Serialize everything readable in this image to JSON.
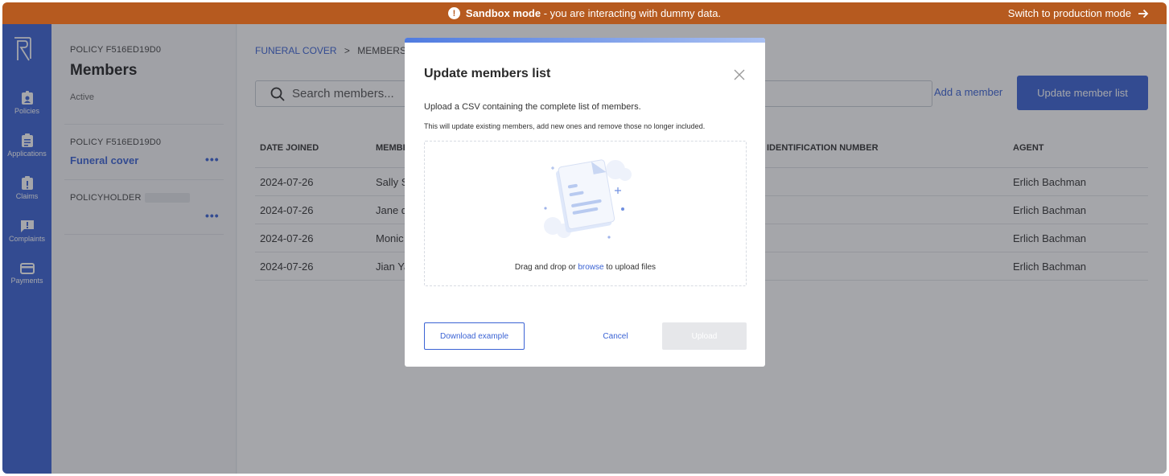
{
  "banner": {
    "title": "Sandbox mode",
    "message": " - you are interacting with dummy data.",
    "switch_label": "Switch to production mode"
  },
  "rail": {
    "items": [
      {
        "label": "Policies",
        "icon": "badge-icon"
      },
      {
        "label": "Applications",
        "icon": "clipboard-icon"
      },
      {
        "label": "Claims",
        "icon": "clipboard-alert-icon"
      },
      {
        "label": "Complaints",
        "icon": "chat-alert-icon"
      },
      {
        "label": "Payments",
        "icon": "card-icon"
      }
    ]
  },
  "sidebar": {
    "policy_label": "POLICY F516ED19D0",
    "title": "Members",
    "status": "Active",
    "policy_label_2": "POLICY F516ED19D0",
    "product_link": "Funeral cover",
    "policyholder_label": "POLICYHOLDER"
  },
  "main": {
    "breadcrumb": {
      "root": "FUNERAL COVER",
      "separator": ">",
      "current": "MEMBERS"
    },
    "search_placeholder": "Search members...",
    "add_member_label": "Add a member",
    "update_button_label": "Update member list",
    "table": {
      "headers": [
        "DATE JOINED",
        "MEMBER",
        "IDENTIFICATION NUMBER",
        "AGENT"
      ],
      "rows": [
        {
          "date": "2024-07-26",
          "member": "Sally S",
          "agent": "Erlich Bachman"
        },
        {
          "date": "2024-07-26",
          "member": "Jane d",
          "agent": "Erlich Bachman"
        },
        {
          "date": "2024-07-26",
          "member": "Monic",
          "agent": "Erlich Bachman"
        },
        {
          "date": "2024-07-26",
          "member": "Jian Ya",
          "agent": "Erlich Bachman"
        }
      ]
    }
  },
  "modal": {
    "title": "Update members list",
    "text1": "Upload a CSV containing the complete list of members.",
    "text2": "This will update existing members, add new ones and remove those no longer included.",
    "drop_prefix": "Drag and drop or ",
    "drop_link": "browse",
    "drop_suffix": " to upload files",
    "download_label": "Download example",
    "cancel_label": "Cancel",
    "upload_label": "Upload"
  },
  "colors": {
    "banner": "#b65a1f",
    "primary": "#3b63d4"
  }
}
